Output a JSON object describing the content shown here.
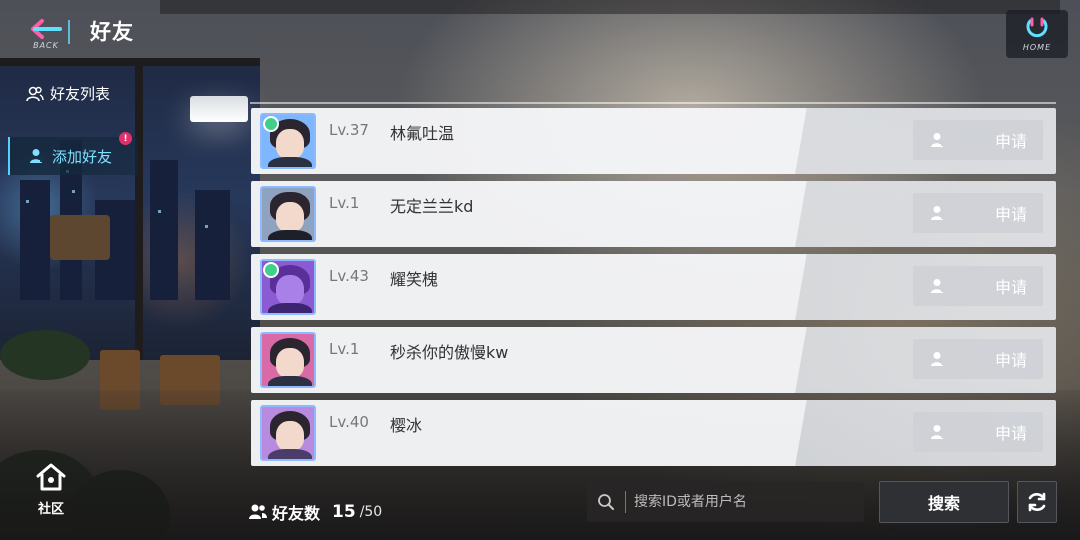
{
  "header": {
    "back_label": "BACK",
    "title": "好友",
    "home_label": "HOME"
  },
  "sidebar": {
    "items": [
      {
        "label": "好友列表",
        "icon": "friends-icon",
        "active": false
      },
      {
        "label": "添加好友",
        "icon": "add-friend-icon",
        "active": true,
        "badge": "!"
      }
    ]
  },
  "list": {
    "rows": [
      {
        "level": "Lv.37",
        "name": "林氟吐温",
        "button": "申请",
        "avatar_color": "#7fb7ff"
      },
      {
        "level": "Lv.1",
        "name": "无定兰兰kd",
        "button": "申请",
        "avatar_color": "#8fa3c0"
      },
      {
        "level": "Lv.43",
        "name": "耀笑槐",
        "button": "申请",
        "avatar_color": "#8a5bd1"
      },
      {
        "level": "Lv.1",
        "name": "秒杀你的傲慢kw",
        "button": "申请",
        "avatar_color": "#d96aa8"
      },
      {
        "level": "Lv.40",
        "name": "樱冰",
        "button": "申请",
        "avatar_color": "#b98be0"
      }
    ]
  },
  "footer": {
    "community_label": "社区",
    "friend_count_label": "好友数",
    "friend_count": "15",
    "friend_max": "/50",
    "search_placeholder": "搜索ID或者用户名",
    "search_button": "搜索"
  },
  "colors": {
    "accent": "#58d0ff",
    "badge": "#e0306a",
    "button_disabled": "#cdd0d4"
  }
}
